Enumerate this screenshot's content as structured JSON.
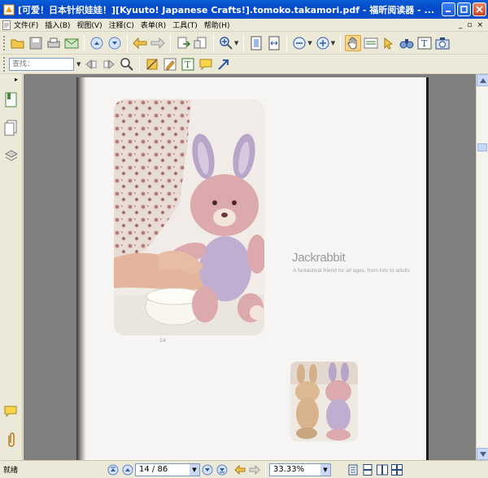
{
  "window": {
    "title": "[可爱！日本针织娃娃！][Kyuuto! Japanese Crafts!].tomoko.takamori.pdf - 福昕阅读器 - ..."
  },
  "menu": {
    "items": [
      "文件(F)",
      "插入(B)",
      "视图(V)",
      "注释(C)",
      "表单(R)",
      "工具(T)",
      "帮助(H)"
    ],
    "right": [
      "_",
      "▫",
      "×"
    ]
  },
  "toolbar": {
    "search_placeholder": "查找："
  },
  "document": {
    "heading": "Jackrabbit",
    "subheading": "A fantastical friend for all ages, from tots to adults",
    "page_label": "14"
  },
  "status": {
    "text": "就绪",
    "page": "14 / 86",
    "zoom": "33.33%"
  },
  "colors": {
    "title_bar": "#0a4ecc",
    "page_bg": "#f6f5f3",
    "viewer_bg": "#808080"
  }
}
